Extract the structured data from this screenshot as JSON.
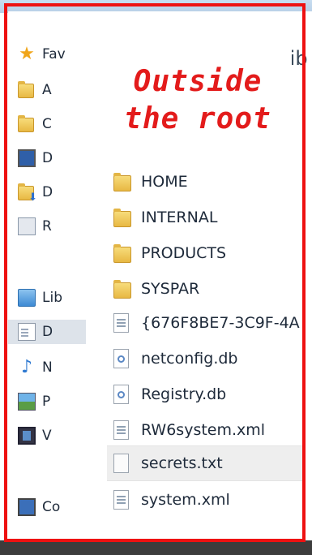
{
  "annotation": {
    "line1": "Outside",
    "line2": "the root",
    "color": "#e31b1b"
  },
  "header": {
    "partial_title": "lib"
  },
  "nav": {
    "items": [
      {
        "label": "Fav",
        "icon": "star-icon"
      },
      {
        "label": "A",
        "icon": "folder-icon"
      },
      {
        "label": "C",
        "icon": "folder-icon"
      },
      {
        "label": "D",
        "icon": "desktop-icon"
      },
      {
        "label": "D",
        "icon": "downloads-folder-icon"
      },
      {
        "label": "R",
        "icon": "recent-places-icon"
      },
      {
        "label": "Lib",
        "icon": "libraries-icon"
      },
      {
        "label": "D",
        "icon": "documents-icon",
        "selected": true
      },
      {
        "label": "N",
        "icon": "music-icon"
      },
      {
        "label": "P",
        "icon": "pictures-icon"
      },
      {
        "label": "V",
        "icon": "videos-icon"
      },
      {
        "label": "Co",
        "icon": "computer-icon"
      }
    ]
  },
  "files": [
    {
      "name": "HOME",
      "type": "folder"
    },
    {
      "name": "INTERNAL",
      "type": "folder"
    },
    {
      "name": "PRODUCTS",
      "type": "folder"
    },
    {
      "name": "SYSPAR",
      "type": "folder"
    },
    {
      "name": "{676F8BE7-3C9F-4A",
      "type": "config"
    },
    {
      "name": "netconfig.db",
      "type": "db"
    },
    {
      "name": "Registry.db",
      "type": "db"
    },
    {
      "name": "RW6system.xml",
      "type": "config"
    },
    {
      "name": "secrets.txt",
      "type": "text",
      "selected": true
    },
    {
      "name": "system.xml",
      "type": "config"
    }
  ],
  "colors": {
    "frame": "#ee1111",
    "selection": "#eeeeee"
  }
}
